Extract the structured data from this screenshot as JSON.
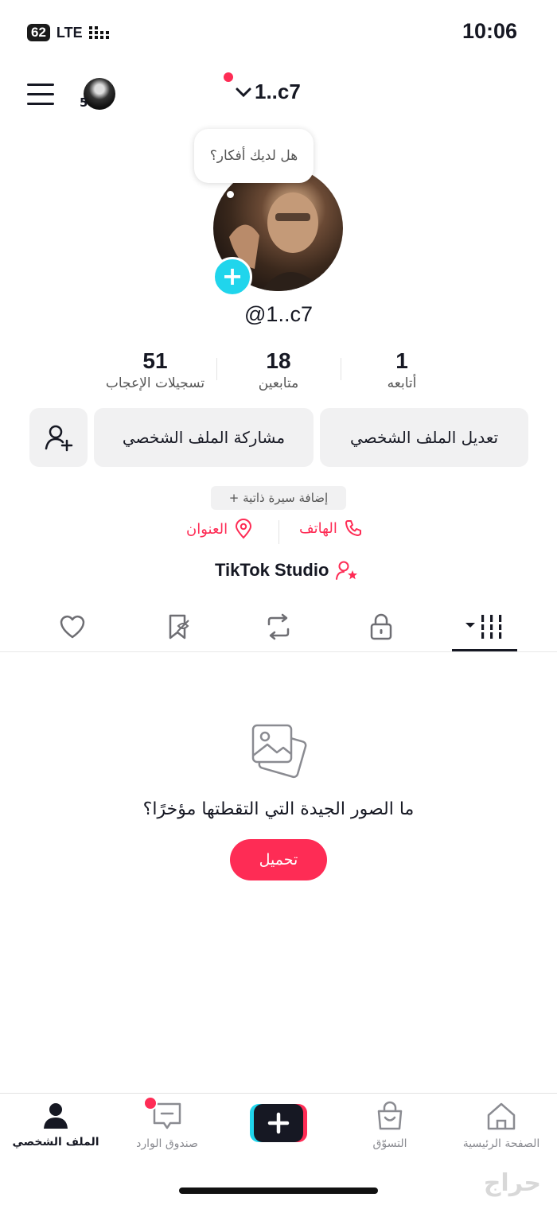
{
  "status_bar": {
    "time": "10:06",
    "battery": "62",
    "network": "LTE"
  },
  "header": {
    "username": "1..c7",
    "notification_count": "5"
  },
  "profile": {
    "bubble_text": "هل لديك أفكار؟",
    "handle": "@1..c7"
  },
  "stats": [
    {
      "value": "51",
      "label": "تسجيلات الإعجاب"
    },
    {
      "value": "18",
      "label": "متابعين"
    },
    {
      "value": "1",
      "label": "أتابعه"
    }
  ],
  "actions": {
    "edit_profile": "تعديل الملف الشخصي",
    "share_profile": "مشاركة الملف الشخصي"
  },
  "bio": {
    "add_bio": "+ إضافة سيرة ذاتية",
    "phone": "الهاتف",
    "address": "العنوان",
    "studio": "TikTok Studio"
  },
  "tabs": [
    "videos-grid",
    "private-lock",
    "reposts",
    "favorites",
    "liked"
  ],
  "empty_state": {
    "message": "ما الصور الجيدة التي التقطتها مؤخرًا؟",
    "upload_label": "تحميل"
  },
  "bottom_nav": {
    "profile": "الملف الشخصي",
    "inbox": "صندوق الوارد",
    "shop": "التسوّق",
    "home": "الصفحة الرئيسية"
  },
  "watermark": "حراج",
  "colors": {
    "accent": "#fe2c55",
    "cyan": "#20d5ec",
    "text": "#161823"
  }
}
